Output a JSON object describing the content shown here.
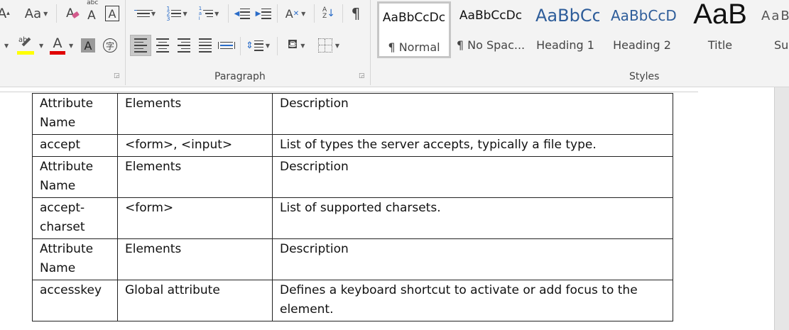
{
  "ribbon": {
    "font": {
      "grow_label": "A",
      "shrink_label": "Aa",
      "highlight_color": "#ffff00",
      "font_color": "#e00000"
    },
    "paragraph": {
      "label": "Paragraph",
      "pilcrow": "¶"
    },
    "styles": {
      "label": "Styles",
      "items": [
        {
          "sample": "AaBbCcDc",
          "name": "¶ Normal"
        },
        {
          "sample": "AaBbCcDc",
          "name": "¶ No Spac..."
        },
        {
          "sample": "AaBbCc",
          "name": "Heading 1"
        },
        {
          "sample": "AaBbCcD",
          "name": "Heading 2"
        },
        {
          "sample": "AaB",
          "name": "Title"
        },
        {
          "sample": "AaB",
          "name": "Su"
        }
      ]
    }
  },
  "document": {
    "rows": [
      [
        "Attribute Name",
        "Elements",
        "Description"
      ],
      [
        "accept",
        "<form>, <input>",
        "List of types the server accepts, typically a file type."
      ],
      [
        "Attribute Name",
        "Elements",
        "Description"
      ],
      [
        "accept-charset",
        "<form>",
        "List of supported charsets."
      ],
      [
        "Attribute Name",
        "Elements",
        "Description"
      ],
      [
        "accesskey",
        "Global attribute",
        "Defines a keyboard shortcut to activate or add focus to the element."
      ]
    ]
  }
}
